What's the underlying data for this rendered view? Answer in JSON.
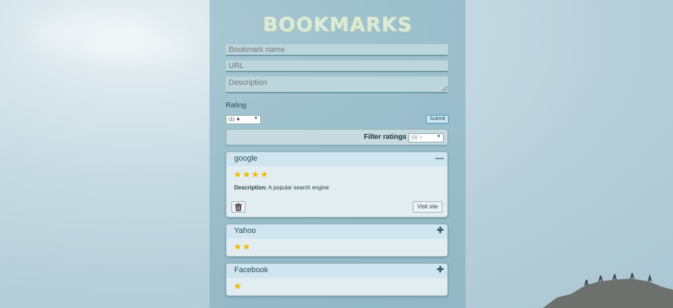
{
  "app": {
    "title": "BOOKMARKS"
  },
  "form": {
    "name_placeholder": "Bookmark name",
    "url_placeholder": "URL",
    "description_placeholder": "Description",
    "rating_label": "Rating",
    "rating_selected": "(1) ★",
    "submit_label": "Submit"
  },
  "filter": {
    "label": "Filter ratings",
    "selected": "(0) ☆"
  },
  "bookmarks": [
    {
      "name": "google",
      "stars": "★★★★",
      "rating": 4,
      "expanded": true,
      "toggle": "—",
      "description_label": "Description:",
      "description": "A popular search engine",
      "visit_label": "Visit site"
    },
    {
      "name": "Yahoo",
      "stars": "★★",
      "rating": 2,
      "expanded": false,
      "toggle": "✚"
    },
    {
      "name": "Facebook",
      "stars": "★",
      "rating": 1,
      "expanded": false,
      "toggle": "✚"
    }
  ],
  "icons": {
    "trash": "trash-icon",
    "collapse": "minus-icon",
    "expand": "plus-icon"
  },
  "colors": {
    "star": "#f2b705",
    "header": "#cfe6f1",
    "panel": "#78aab9"
  }
}
